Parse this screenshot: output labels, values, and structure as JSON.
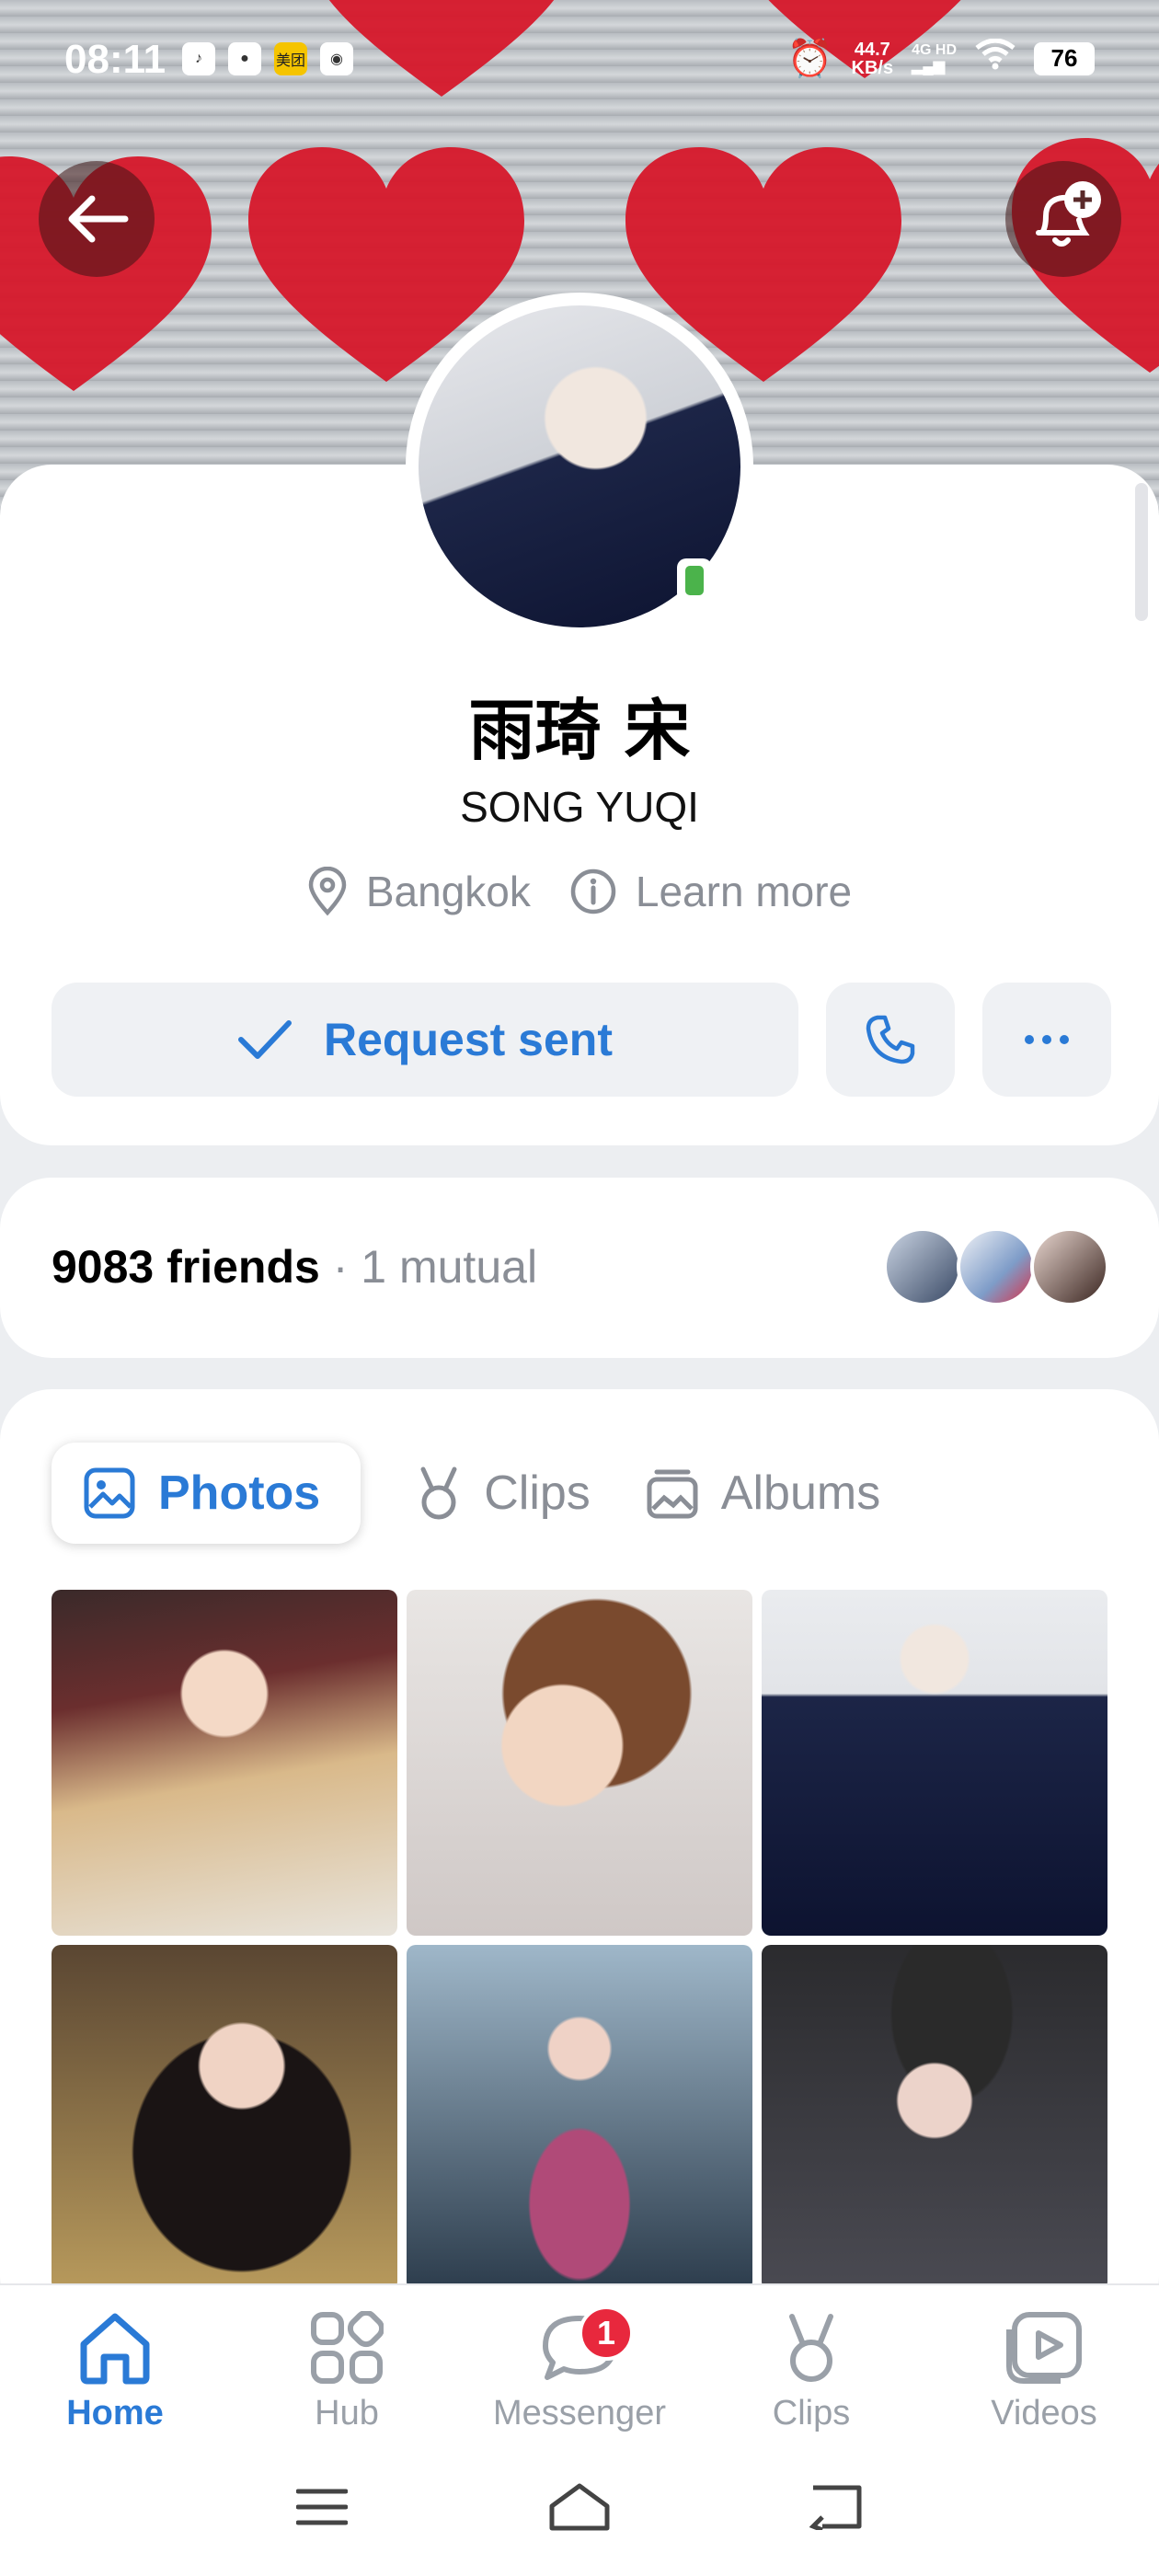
{
  "status_bar": {
    "time": "08:11",
    "net_speed": "44.7",
    "net_unit": "KB/s",
    "network": "4G HD",
    "battery": "76",
    "app_icons": [
      "douyin-icon",
      "app-icon",
      "美团",
      "music-icon"
    ]
  },
  "header": {
    "back_icon": "arrow-left-icon",
    "notify_icon": "bell-plus-icon"
  },
  "profile": {
    "name": "雨琦 宋",
    "latin_name": "SONG YUQI",
    "location": "Bangkok",
    "learn_more": "Learn more",
    "online_status_color": "#4bb34b",
    "request_label": "Request sent"
  },
  "friends": {
    "count_label": "9083 friends",
    "mutual_label": "· 1 mutual"
  },
  "media_tabs": [
    {
      "label": "Photos",
      "icon": "image-icon",
      "active": true
    },
    {
      "label": "Clips",
      "icon": "clips-icon",
      "active": false
    },
    {
      "label": "Albums",
      "icon": "albums-icon",
      "active": false
    }
  ],
  "bottom_nav": [
    {
      "label": "Home",
      "icon": "home-icon",
      "active": true
    },
    {
      "label": "Hub",
      "icon": "grid-icon",
      "active": false
    },
    {
      "label": "Messenger",
      "icon": "chat-bubble-icon",
      "badge": "1",
      "active": false
    },
    {
      "label": "Clips",
      "icon": "clips-icon",
      "active": false
    },
    {
      "label": "Videos",
      "icon": "video-play-icon",
      "active": false
    }
  ],
  "colors": {
    "accent": "#2a7ad6",
    "badge": "#e8283d"
  }
}
